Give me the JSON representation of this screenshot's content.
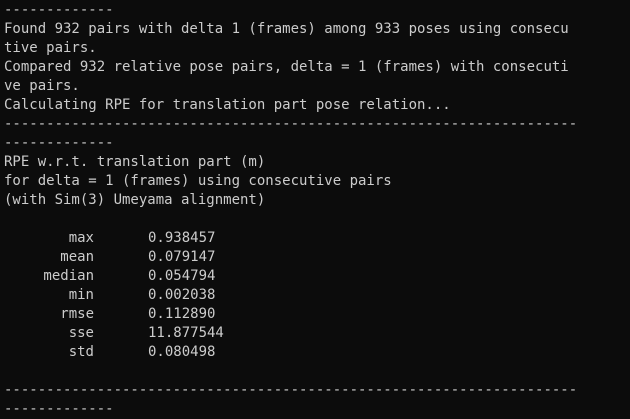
{
  "lines_top": [
    "-------------",
    "Found 932 pairs with delta 1 (frames) among 933 poses using consecu",
    "tive pairs.",
    "Compared 932 relative pose pairs, delta = 1 (frames) with consecuti",
    "ve pairs.",
    "Calculating RPE for translation part pose relation...",
    "--------------------------------------------------------------------",
    "-------------",
    "RPE w.r.t. translation part (m)",
    "for delta = 1 (frames) using consecutive pairs",
    "(with Sim(3) Umeyama alignment)"
  ],
  "stats": [
    {
      "label": "max",
      "value": "0.938457"
    },
    {
      "label": "mean",
      "value": "0.079147"
    },
    {
      "label": "median",
      "value": "0.054794"
    },
    {
      "label": "min",
      "value": "0.002038"
    },
    {
      "label": "rmse",
      "value": "0.112890"
    },
    {
      "label": "sse",
      "value": "11.877544"
    },
    {
      "label": "std",
      "value": "0.080498"
    }
  ],
  "lines_bottom": [
    "--------------------------------------------------------------------",
    "-------------"
  ]
}
